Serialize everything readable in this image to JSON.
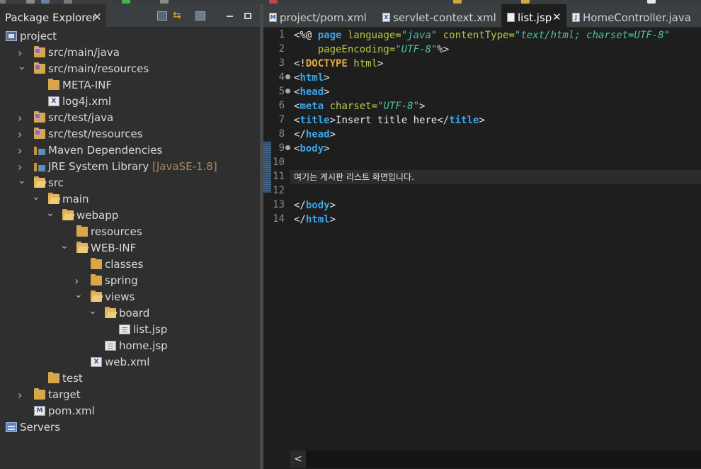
{
  "explorer": {
    "title": "Package Explorer",
    "close": "✕",
    "tree": [
      {
        "label": "project",
        "icon": "project-icon",
        "depth": 0,
        "twisty": ""
      },
      {
        "label": "src/main/java",
        "icon": "package-folder-icon",
        "depth": 1,
        "twisty": "collapsed"
      },
      {
        "label": "src/main/resources",
        "icon": "package-folder-icon",
        "depth": 1,
        "twisty": "expanded"
      },
      {
        "label": "META-INF",
        "icon": "folder-icon",
        "depth": 2,
        "twisty": ""
      },
      {
        "label": "log4j.xml",
        "icon": "xml-file-icon",
        "depth": 2,
        "twisty": ""
      },
      {
        "label": "src/test/java",
        "icon": "package-folder-icon",
        "depth": 1,
        "twisty": "collapsed"
      },
      {
        "label": "src/test/resources",
        "icon": "package-folder-icon",
        "depth": 1,
        "twisty": "collapsed"
      },
      {
        "label": "Maven Dependencies",
        "icon": "library-icon",
        "depth": 1,
        "twisty": "collapsed"
      },
      {
        "label": "JRE System Library",
        "decoration": "[JavaSE-1.8]",
        "icon": "library-icon",
        "depth": 1,
        "twisty": "collapsed"
      },
      {
        "label": "src",
        "icon": "folder-icon",
        "depth": 1,
        "twisty": "expanded"
      },
      {
        "label": "main",
        "icon": "folder-icon",
        "depth": 2,
        "twisty": "expanded"
      },
      {
        "label": "webapp",
        "icon": "folder-icon",
        "depth": 3,
        "twisty": "expanded"
      },
      {
        "label": "resources",
        "icon": "folder-icon",
        "depth": 4,
        "twisty": ""
      },
      {
        "label": "WEB-INF",
        "icon": "folder-icon",
        "depth": 4,
        "twisty": "expanded"
      },
      {
        "label": "classes",
        "icon": "folder-icon",
        "depth": 5,
        "twisty": ""
      },
      {
        "label": "spring",
        "icon": "folder-icon",
        "depth": 5,
        "twisty": "collapsed"
      },
      {
        "label": "views",
        "icon": "folder-icon",
        "depth": 5,
        "twisty": "expanded"
      },
      {
        "label": "board",
        "icon": "folder-icon",
        "depth": 6,
        "twisty": "expanded"
      },
      {
        "label": "list.jsp",
        "icon": "jsp-file-icon",
        "depth": 7,
        "twisty": ""
      },
      {
        "label": "home.jsp",
        "icon": "jsp-file-icon",
        "depth": 6,
        "twisty": ""
      },
      {
        "label": "web.xml",
        "icon": "xml-file-icon",
        "depth": 5,
        "twisty": ""
      },
      {
        "label": "test",
        "icon": "folder-icon",
        "depth": 2,
        "twisty": ""
      },
      {
        "label": "target",
        "icon": "folder-icon",
        "depth": 1,
        "twisty": "collapsed"
      },
      {
        "label": "pom.xml",
        "icon": "pom-file-icon",
        "depth": 1,
        "twisty": ""
      },
      {
        "label": "Servers",
        "icon": "servers-icon",
        "depth": 0,
        "twisty": ""
      }
    ]
  },
  "editor": {
    "tabs": [
      {
        "label": "project/pom.xml",
        "icon": "pom-file-icon",
        "active": false
      },
      {
        "label": "servlet-context.xml",
        "icon": "xml-file-icon",
        "active": false
      },
      {
        "label": "list.jsp",
        "icon": "jsp-file-icon",
        "active": true,
        "close": "✕"
      },
      {
        "label": "HomeController.java",
        "icon": "java-file-icon",
        "active": false
      }
    ],
    "line_numbers": [
      "1",
      "2",
      "3",
      "4",
      "5",
      "6",
      "7",
      "8",
      "9",
      "10",
      "11",
      "12",
      "13",
      "14"
    ],
    "lines": [
      [
        [
          "t-delim",
          "<%@ "
        ],
        [
          "t-kw",
          "page "
        ],
        [
          "t-attr",
          "language="
        ],
        [
          "t-val",
          "\"java\" "
        ],
        [
          "t-attr",
          "contentType="
        ],
        [
          "t-val",
          "\"text/html; charset=UTF-8\""
        ]
      ],
      [
        [
          "t-text",
          "    "
        ],
        [
          "t-attr",
          "pageEncoding="
        ],
        [
          "t-val",
          "\"UTF-8\""
        ],
        [
          "t-delim",
          "%>"
        ]
      ],
      [
        [
          "t-delim",
          "<!"
        ],
        [
          "t-doc",
          "DOCTYPE "
        ],
        [
          "t-attr",
          "html"
        ],
        [
          "t-delim",
          ">"
        ]
      ],
      [
        [
          "t-delim",
          "<"
        ],
        [
          "t-kw",
          "html"
        ],
        [
          "t-delim",
          ">"
        ]
      ],
      [
        [
          "t-delim",
          "<"
        ],
        [
          "t-kw",
          "head"
        ],
        [
          "t-delim",
          ">"
        ]
      ],
      [
        [
          "t-delim",
          "<"
        ],
        [
          "t-kw",
          "meta "
        ],
        [
          "t-attr",
          "charset="
        ],
        [
          "t-val",
          "\"UTF-8\""
        ],
        [
          "t-delim",
          ">"
        ]
      ],
      [
        [
          "t-delim",
          "<"
        ],
        [
          "t-kw",
          "title"
        ],
        [
          "t-delim",
          ">"
        ],
        [
          "t-text",
          "Insert title here"
        ],
        [
          "t-delim",
          "</"
        ],
        [
          "t-kw",
          "title"
        ],
        [
          "t-delim",
          ">"
        ]
      ],
      [
        [
          "t-delim",
          "</"
        ],
        [
          "t-kw",
          "head"
        ],
        [
          "t-delim",
          ">"
        ]
      ],
      [
        [
          "t-delim",
          "<"
        ],
        [
          "t-kw",
          "body"
        ],
        [
          "t-delim",
          ">"
        ]
      ],
      [],
      [
        [
          "t-text t-ko",
          "여기는 게시판 리스트 화면입니다."
        ]
      ],
      [],
      [
        [
          "t-delim",
          "</"
        ],
        [
          "t-kw",
          "body"
        ],
        [
          "t-delim",
          ">"
        ]
      ],
      [
        [
          "t-delim",
          "</"
        ],
        [
          "t-kw",
          "html"
        ],
        [
          "t-delim",
          ">"
        ]
      ]
    ],
    "folded_lines": [
      4,
      5,
      9
    ],
    "current_line": 11,
    "scroll_left_arrow": "<"
  }
}
